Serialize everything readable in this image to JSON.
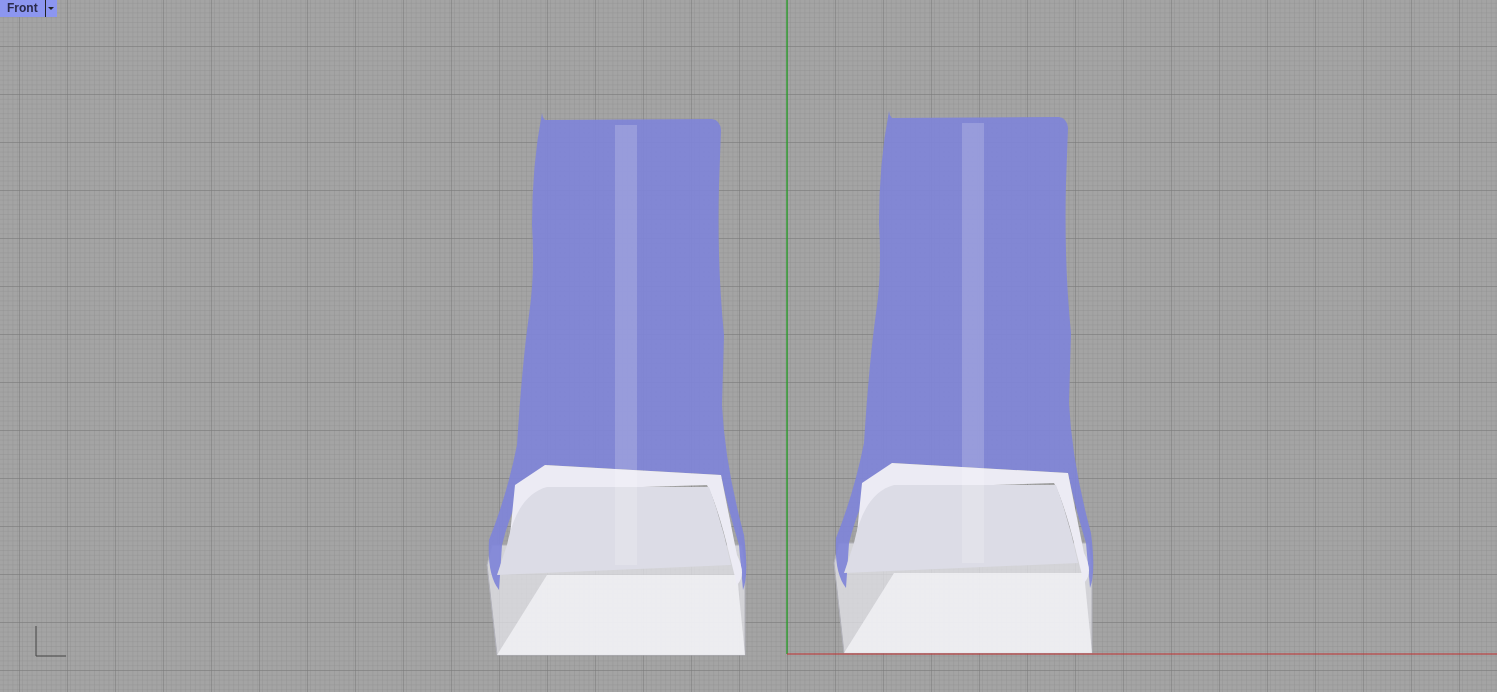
{
  "viewport": {
    "title": "Front"
  }
}
